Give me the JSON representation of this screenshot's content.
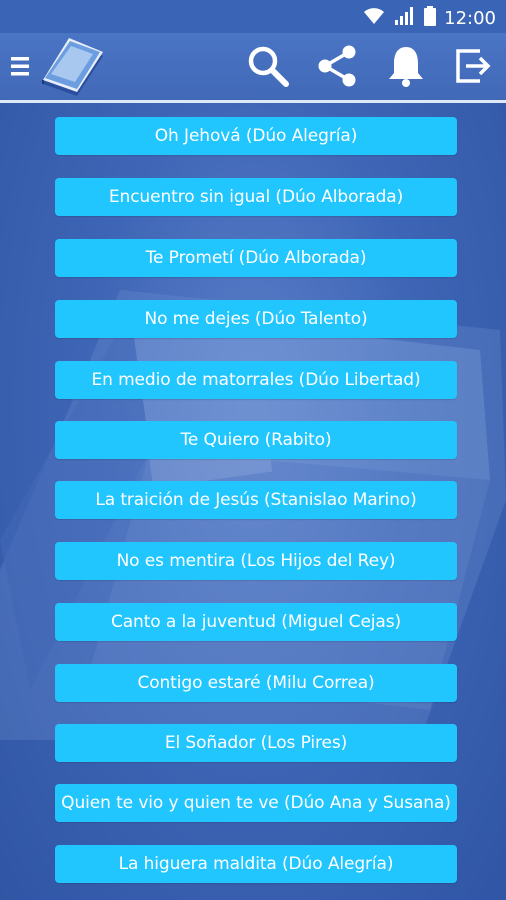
{
  "status_bar": {
    "time": "12:00",
    "icons": [
      "wifi-icon",
      "signal-icon",
      "battery-icon"
    ]
  },
  "toolbar": {
    "icons": [
      "menu-icon",
      "songbook-logo-icon",
      "search-icon",
      "share-icon",
      "bell-icon",
      "exit-icon"
    ]
  },
  "songs": [
    "Oh Jehová (Dúo Alegría)",
    "Encuentro sin igual (Dúo Alborada)",
    "Te Prometí (Dúo Alborada)",
    "No me dejes (Dúo Talento)",
    "En medio de matorrales (Dúo Libertad)",
    "Te Quiero (Rabito)",
    "La traición de Jesús (Stanislao Marino)",
    "No es mentira (Los Hijos del Rey)",
    "Canto a la juventud (Miguel Cejas)",
    "Contigo estaré (Milu Correa)",
    "El Soñador (Los Pires)",
    "Quien te vio y quien te ve (Dúo Ana y Susana)",
    "La higuera maldita (Dúo Alegría)"
  ],
  "colors": {
    "status_bar": "#3a64b5",
    "toolbar": "#4169b8",
    "button": "#21c6ff",
    "background": "#3f66b6"
  }
}
